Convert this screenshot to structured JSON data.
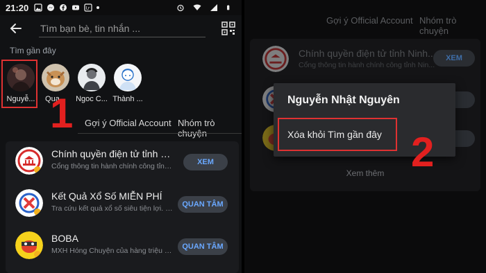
{
  "status_bar": {
    "time": "21:20"
  },
  "search": {
    "placeholder": "Tìm bạn bè, tin nhắn ..."
  },
  "recent_section": {
    "label": "Tìm gần đây"
  },
  "recents": [
    {
      "name": "Nguyễ...",
      "bg": "#5a3a3a"
    },
    {
      "name": "Qua...",
      "bg": "#b98a5a"
    },
    {
      "name": "Ngoc C...",
      "bg": "#9aa0a8"
    },
    {
      "name": "Thành ...",
      "bg": "#dfe6ee"
    }
  ],
  "tabs": {
    "oa": "Gợi ý Official Account",
    "groups": "Nhóm trò chuyện"
  },
  "oa_list": [
    {
      "title": "Chính quyền điện tử tỉnh Ninh...",
      "desc": "Cổng thông tin hành chính công tỉnh Nin...",
      "button": "XEM"
    },
    {
      "title": "Kết Quả Xổ Số MIỄN PHÍ",
      "desc": "Tra cứu kết quả xổ số siêu tiện lợi. Sử...",
      "button": "QUAN TÂM"
    },
    {
      "title": "BOBA",
      "desc": "MXH Hóng Chuyện của hàng triệu bạ...",
      "button": "QUAN TÂM"
    }
  ],
  "steps": {
    "one": "1",
    "two": "2"
  },
  "right": {
    "tab_oa": "Gợi ý Official Account",
    "tab_groups": "Nhóm trò chuyện",
    "row1_title": "Chính quyền điện tử tỉnh Ninh...",
    "row1_desc": "Cổng thông tin hành chính công tỉnh Nin...",
    "row1_button": "XEM",
    "more": "Xem thêm"
  },
  "menu": {
    "title": "Nguyễn Nhật Nguyên",
    "item_remove": "Xóa khỏi Tìm gần đây"
  },
  "colors": {
    "accent_blue": "#6aa8ff",
    "highlight_red": "#e03232",
    "bg_dark": "#111214"
  }
}
